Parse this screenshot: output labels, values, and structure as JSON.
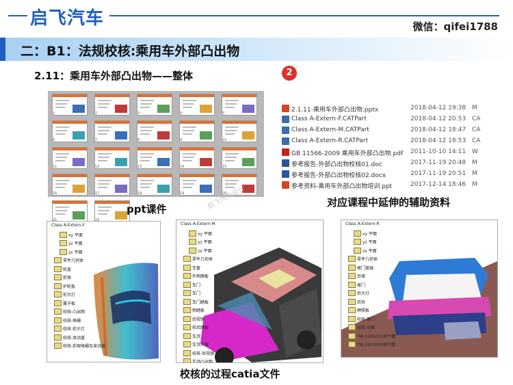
{
  "header": {
    "brand": "启飞汽车",
    "wechat": "微信：qifei1788"
  },
  "section": {
    "title": "二：B1：法规校核:乘用车外部凸出物",
    "subtitle": "2.11：乘用车外部凸出物——整体",
    "badge": "2"
  },
  "ppt": {
    "caption": "ppt课件",
    "slide_numbers": [
      "1",
      "2",
      "3",
      "4",
      "5",
      "6",
      "7",
      "8",
      "9",
      "10",
      "11",
      "12",
      "13",
      "14",
      "15",
      "16",
      "17",
      "18",
      "19",
      "20",
      "21",
      "22"
    ]
  },
  "files": {
    "caption": "对应课程中延伸的辅助资料",
    "rows": [
      {
        "name": "2.1.11-乘用车外部凸出物.pptx",
        "date": "2018-04-12 19:38",
        "type": "M",
        "icon_color": "#d24726"
      },
      {
        "name": "Class A-Extern-F.CATPart",
        "date": "2018-04-12 20:53",
        "type": "CA",
        "icon_color": "#3a6ea5"
      },
      {
        "name": "Class A-Extern-M.CATPart",
        "date": "2018-04-12 18:47",
        "type": "CA",
        "icon_color": "#3a6ea5"
      },
      {
        "name": "Class A-Extern-R.CATPart",
        "date": "2018-04-12 18:53",
        "type": "CA",
        "icon_color": "#3a6ea5"
      },
      {
        "name": "GB 11566-2009 乘用车外部凸出物.pdf",
        "date": "2011-10-10 14:11",
        "type": "W",
        "icon_color": "#c8201e"
      },
      {
        "name": "参考报告-外部凸出物校核01.doc",
        "date": "2017-11-19 20:48",
        "type": "M",
        "icon_color": "#2b579a"
      },
      {
        "name": "参考报告-外部凸出物校核02.docx",
        "date": "2017-11-19 20:51",
        "type": "M",
        "icon_color": "#2b579a"
      },
      {
        "name": "参考资料-乘用车外部凸出物培训.ppt",
        "date": "2017-12-14 18:46",
        "type": "M",
        "icon_color": "#d24726"
      }
    ]
  },
  "catia": {
    "caption": "校核的过程catia文件",
    "watermark": "启飞汽车设计",
    "panels": [
      {
        "title": "Class A-Extern-F",
        "items": [
          "xy 平面",
          "yz 平面",
          "zx 平面",
          "零件几何体",
          "机盖",
          "前保",
          "护轮板",
          "前大灯",
          "翼子板",
          "校核-凸出物",
          "校核-格栅",
          "校核-前大灯",
          "校核-发动盖",
          "校核-前保格栅及发动盖"
        ]
      },
      {
        "title": "Class A-Extern-M",
        "items": [
          "xy 平面",
          "yz 平面",
          "zx 平面",
          "零件几何体",
          "车窗",
          "外侧踏板",
          "车门",
          "车门",
          "车门踏板",
          "侧踏板",
          "后视镜",
          "前后踏板",
          "车顶",
          "车顶天窗",
          "校核-后视镜",
          "车顶凸出物",
          "校核-车门",
          "校核-车门把手",
          "校核-车顶",
          "校核-踏板"
        ]
      },
      {
        "title": "Class A-Extern-R",
        "items": [
          "xy 平面",
          "yz 平面",
          "zx 平面",
          "零件几何体",
          "尾门玻璃",
          "后保",
          "尾门",
          "后大灯",
          "后饰",
          "牌照板",
          "校核-尾门",
          "校核-后保",
          "TW-1201001排气管",
          "TW-1201001排气管"
        ]
      }
    ]
  },
  "colors": {
    "brand_blue": "#1f5fbf",
    "banner_light": "#a9d0f2",
    "badge_red": "#d9342b",
    "orange_accent": "#e36d2c"
  }
}
